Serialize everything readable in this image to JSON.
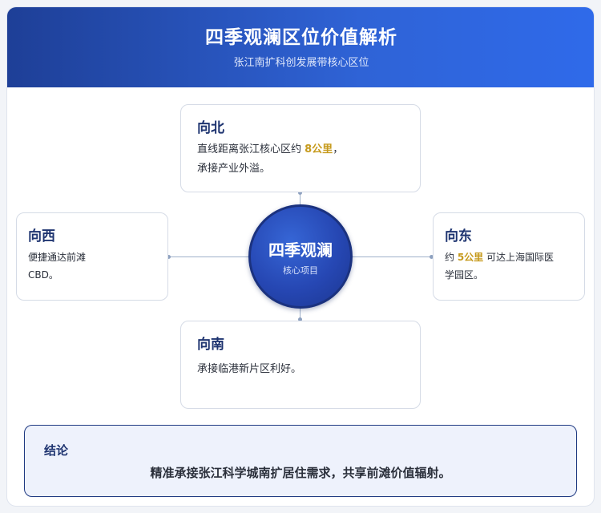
{
  "header": {
    "title": "四季观澜区位价值解析",
    "subtitle": "张江南扩科创发展带核心区位"
  },
  "center": {
    "title": "四季观澜",
    "subtitle": "核心项目"
  },
  "north": {
    "title": "向北",
    "line1_pre": "直线距离张江核心区约 ",
    "line1_hl": "8公里",
    "line1_post": "，",
    "line2": "承接产业外溢。"
  },
  "west": {
    "title": "向西",
    "line1": "便捷通达前滩",
    "line2": "CBD。"
  },
  "east": {
    "title": "向东",
    "line1_pre": "约 ",
    "line1_hl": "5公里",
    "line1_post": " 可达上海国际医",
    "line2": "学园区。"
  },
  "south": {
    "title": "向南",
    "line1": "承接临港新片区利好。"
  },
  "conclusion": {
    "label": "结论",
    "text": "精准承接张江科学城南扩居住需求，共享前滩价值辐射。"
  },
  "colors": {
    "header_start": "#1e3f97",
    "header_end": "#2f6aea",
    "highlight": "#c69a1c",
    "heading": "#1e3470"
  }
}
